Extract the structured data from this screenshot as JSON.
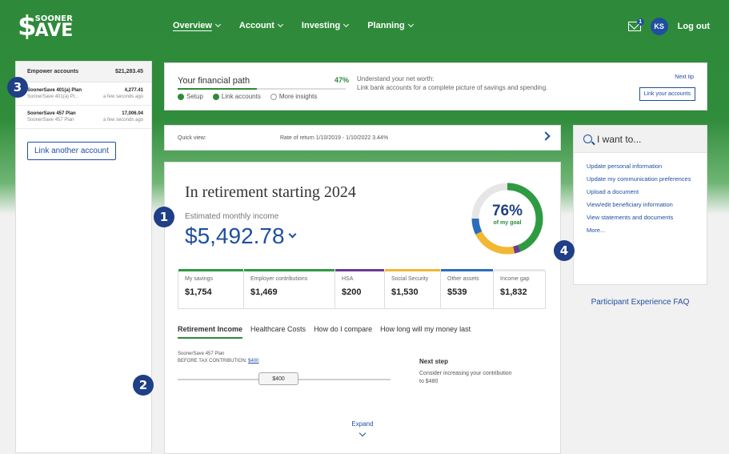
{
  "header": {
    "logo_mark": "$",
    "logo_top": "SOONER",
    "logo_bottom": "AVE",
    "nav": [
      "Overview",
      "Account",
      "Investing",
      "Planning"
    ],
    "mail_count": "1",
    "avatar_initials": "KS",
    "logout": "Log out"
  },
  "accounts": {
    "header_label": "Empower accounts",
    "header_total": "$21,283.45",
    "items": [
      {
        "name": "SoonerSave 401(a) Plan",
        "amount": "4,277.41",
        "sub": "SoonerSave 401(a) Pl...",
        "updated": "a few seconds ago"
      },
      {
        "name": "SoonerSave 457 Plan",
        "amount": "17,006.04",
        "sub": "SoonerSave 457 Plan",
        "updated": "a few seconds ago"
      }
    ],
    "link_another": "Link another account"
  },
  "callouts": [
    "1",
    "2",
    "3",
    "4"
  ],
  "financial_path": {
    "title": "Your financial path",
    "percent": "47%",
    "progress": 0.47,
    "steps": [
      "Setup",
      "Link accounts",
      "More insights"
    ],
    "understand": "Understand your net worth:",
    "understand_desc": "Link bank accounts for a complete picture of savings and spending.",
    "next_tip": "Next tip",
    "link_accounts": "Link your accounts"
  },
  "quick_view": {
    "label": "Quick view:",
    "rate": "Rate of return  1/10/2019 - 1/10/2022  3.44%"
  },
  "retirement": {
    "title": "In retirement starting 2024",
    "est_label": "Estimated monthly income",
    "est_value": "$5,492.78",
    "goal_pct": "76%",
    "goal_sub": "of my goal",
    "sources": [
      {
        "label": "My savings",
        "value": "$1,754",
        "color": "#2e9a42"
      },
      {
        "label": "Employer contributions",
        "value": "$1,469",
        "color": "#2e9a42"
      },
      {
        "label": "HSA",
        "value": "$200",
        "color": "#6a3a96"
      },
      {
        "label": "Social Security",
        "value": "$1,530",
        "color": "#f2b733"
      },
      {
        "label": "Other assets",
        "value": "$539",
        "color": "#2a6ebb"
      },
      {
        "label": "Income gap",
        "value": "$1,832",
        "color": "#e8e8e8"
      }
    ],
    "tabs": [
      "Retirement Income",
      "Healthcare Costs",
      "How do I compare",
      "How long will my money last"
    ],
    "plan_name": "SoonerSave 457 Plan",
    "contribution_label": "BEFORE TAX CONTRIBUTION:",
    "contribution_value": "$400",
    "slider_value": "$400",
    "next_step_title": "Next step",
    "next_step_text": "Consider increasing your contribution to $480",
    "expand": "Expand"
  },
  "i_want_to": {
    "title": "I want to...",
    "items": [
      "Update personal information",
      "Update my communication preferences",
      "Upload a document",
      "View/edit beneficiary information",
      "View statements and documents",
      "More..."
    ],
    "faq": "Participant Experience FAQ"
  }
}
